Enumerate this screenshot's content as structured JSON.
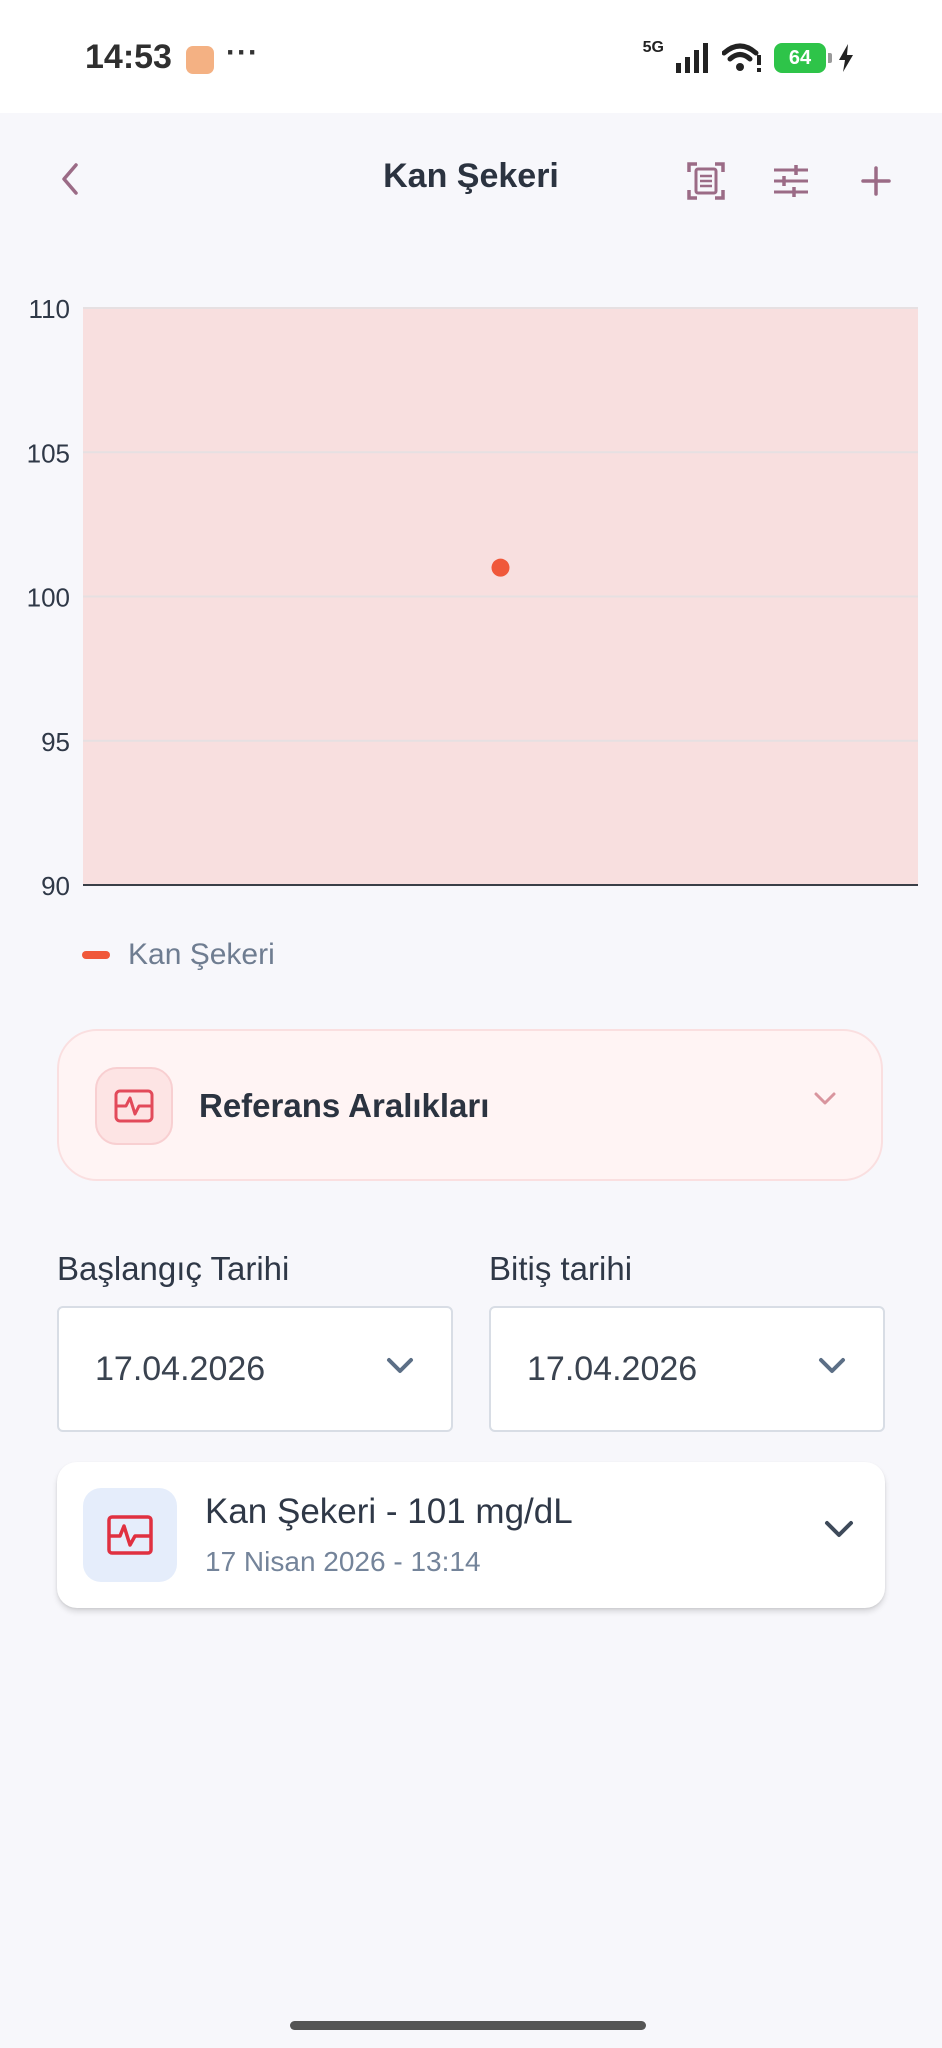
{
  "status_bar": {
    "time": "14:53",
    "dots": "···",
    "network": "5G",
    "battery": "64"
  },
  "header": {
    "title": "Kan Şekeri",
    "back_icon": "chevron-left-icon",
    "actions": [
      "scan-document-icon",
      "tune-icon",
      "plus-icon"
    ]
  },
  "chart_data": {
    "type": "scatter",
    "title": "",
    "xlabel": "",
    "ylabel": "",
    "ylim": [
      90,
      110
    ],
    "y_ticks": [
      "110",
      "105",
      "100",
      "95",
      "90"
    ],
    "grid": true,
    "legend_placement": "bottom-left",
    "series": [
      {
        "name": "Kan Şekeri",
        "color": "#f0583a",
        "points": [
          {
            "x": "17 Nisan 2026 - 13:14",
            "y": 101
          }
        ]
      }
    ],
    "reference_band": {
      "from": 90,
      "to": 110,
      "color": "#f8dfdf"
    }
  },
  "reference": {
    "title": "Referans Aralıkları",
    "icon": "heart-monitor-icon"
  },
  "dates": {
    "start_label": "Başlangıç Tarihi",
    "start_value": "17.04.2026",
    "end_label": "Bitiş tarihi",
    "end_value": "17.04.2026"
  },
  "entry": {
    "title": "Kan Şekeri - 101 mg/dL",
    "subtitle": "17 Nisan 2026 - 13:14",
    "icon": "heart-monitor-icon"
  },
  "colors": {
    "accent": "#9b6b86",
    "series": "#f0583a",
    "band": "#f8dfdf"
  }
}
